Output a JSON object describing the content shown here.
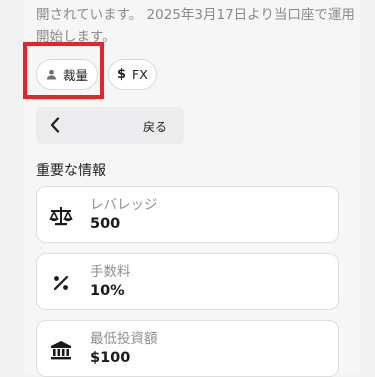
{
  "description": "開されています。 2025年3月17日より当口座で運用開始します。",
  "chips": [
    {
      "icon": "person-icon",
      "label": "裁量"
    },
    {
      "icon": "dollar-icon",
      "label": "FX"
    }
  ],
  "back_button": {
    "icon": "chevron-left-icon",
    "label": "戻る"
  },
  "section_title": "重要な情報",
  "info_cards": [
    {
      "icon": "scale-icon",
      "label": "レバレッジ",
      "value": "500"
    },
    {
      "icon": "percent-icon",
      "label": "手数料",
      "value": "10%"
    },
    {
      "icon": "bank-icon",
      "label": "最低投資額",
      "value": "$100"
    }
  ],
  "highlight_color": "#e2262b"
}
